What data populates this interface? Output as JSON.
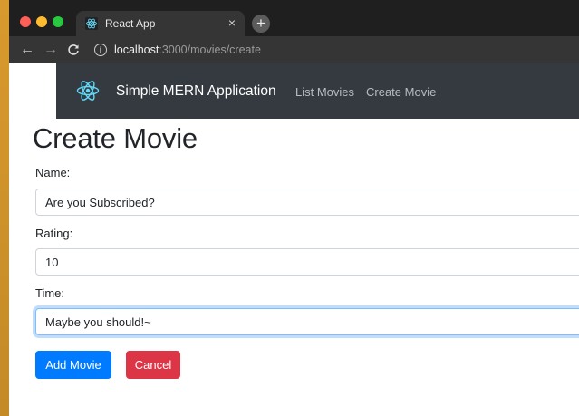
{
  "browser": {
    "tab_title": "React App",
    "tab_close": "×",
    "new_tab": "+",
    "back": "←",
    "forward": "→",
    "reload": "C",
    "url_host": "localhost",
    "url_path": ":3000/movies/create"
  },
  "navbar": {
    "brand": "Simple MERN Application",
    "links": [
      "List Movies",
      "Create Movie"
    ],
    "logo_icon": "react-icon"
  },
  "page": {
    "title": "Create Movie"
  },
  "form": {
    "name_label": "Name:",
    "name_value": "Are you Subscribed?",
    "rating_label": "Rating:",
    "rating_value": "10",
    "time_label": "Time:",
    "time_value": "Maybe you should!~"
  },
  "buttons": {
    "add": "Add Movie",
    "cancel": "Cancel"
  },
  "colors": {
    "navbar": "#343a40",
    "primary": "#007bff",
    "danger": "#dc3545"
  }
}
